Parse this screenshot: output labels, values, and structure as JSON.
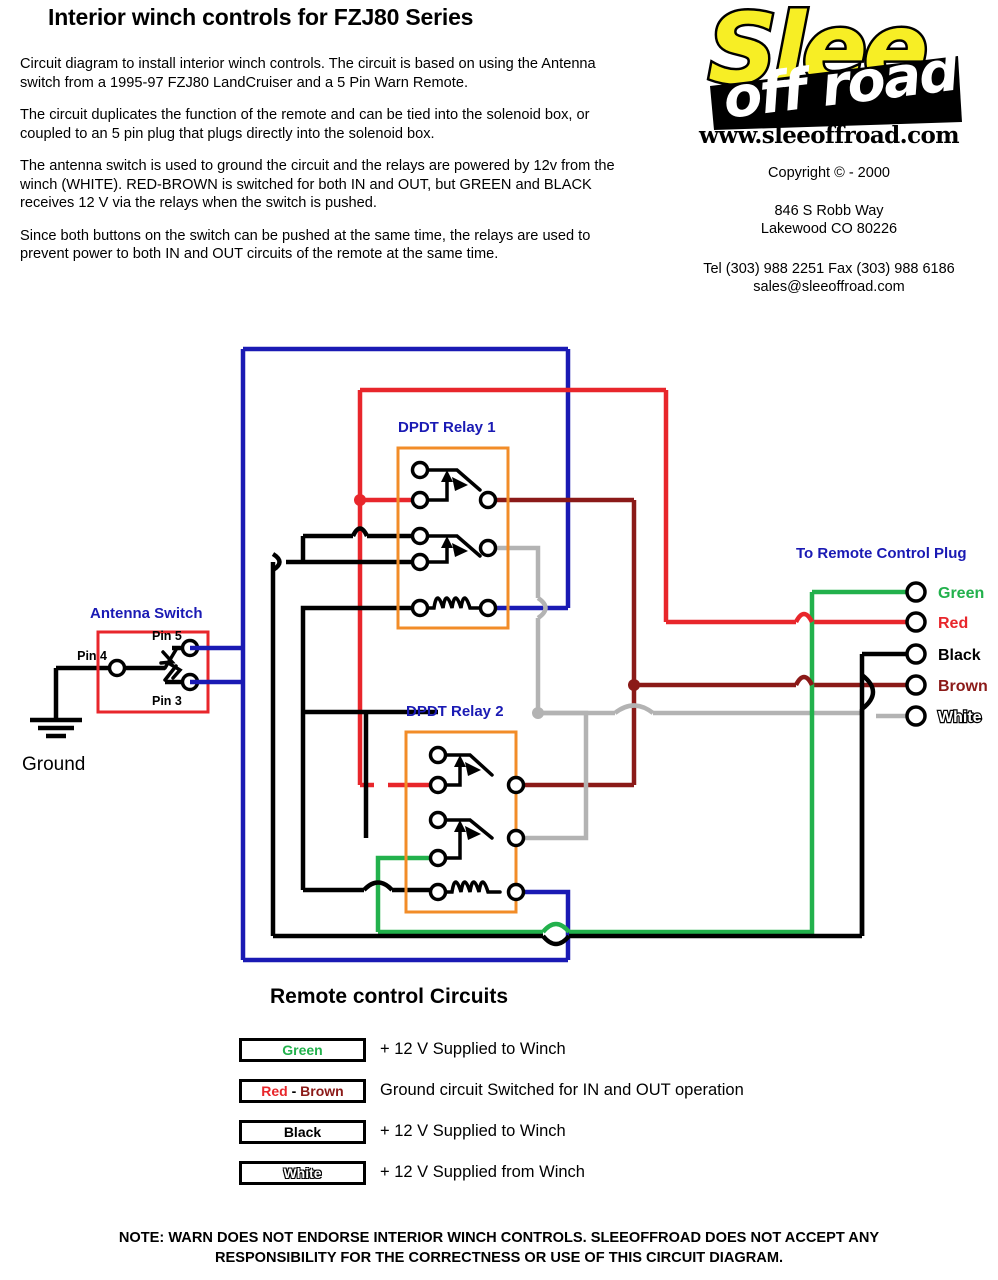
{
  "document": {
    "title": "Interior winch controls for FZJ80 Series",
    "paragraphs": [
      "Circuit diagram to install interior winch controls. The circuit is based on using the Antenna switch from a 1995-97 FZJ80 LandCruiser and a 5 Pin Warn Remote.",
      "The circuit duplicates the function of the remote and can be tied into the solenoid box, or coupled to an 5 pin plug that plugs directly into the solenoid box.",
      "The antenna switch is used to ground the circuit and the relays are powered by 12v from the winch (WHITE). RED-BROWN is switched for both IN and OUT, but GREEN and BLACK receives 12 V via the relays when the switch is pushed.",
      "Since both buttons on the switch can be pushed at the same time, the relays are used to prevent power to both IN and OUT circuits of the remote at the same time."
    ],
    "footer_note_line1": "NOTE: WARN DOES NOT ENDORSE INTERIOR WINCH CONTROLS. SLEEOFFROAD DOES NOT ACCEPT ANY",
    "footer_note_line2": "RESPONSIBILITY FOR THE CORRECTNESS OR USE OF THIS CIRCUIT DIAGRAM."
  },
  "company": {
    "logo_word_top": "Slee",
    "logo_word_bottom": "off road",
    "website": "www.sleeoffroad.com",
    "copyright": "Copyright © - 2000",
    "address_line1": "846 S Robb Way",
    "address_line2": "Lakewood CO 80226",
    "phone_line": "Tel (303) 988 2251 Fax (303) 988 6186",
    "email": "sales@sleeoffroad.com"
  },
  "diagram": {
    "antenna_switch": {
      "title": "Antenna Switch",
      "pin_left": "Pin 4",
      "pin_top": "Pin 5",
      "pin_bottom": "Pin 3",
      "ground_label": "Ground",
      "box_color": "#e8262b"
    },
    "relay1_label": "DPDT Relay 1",
    "relay2_label": "DPDT Relay 2",
    "relay_box_color": "#f28c28",
    "label_color": "#1a1ab4",
    "plug": {
      "title": "To Remote Control Plug",
      "terminals": [
        {
          "name": "Green",
          "color": "#22b14c"
        },
        {
          "name": "Red",
          "color": "#e8262b"
        },
        {
          "name": "Black",
          "color": "#000000"
        },
        {
          "name": "Brown",
          "color": "#8b1a18"
        },
        {
          "name": "White",
          "color": "#ffffff"
        }
      ]
    },
    "wire_colors": {
      "blue": "#1a1ab4",
      "red": "#e8262b",
      "brown": "#8b1a18",
      "black": "#000000",
      "green": "#22b14c",
      "white": "#b3b3b3"
    }
  },
  "legend": {
    "title": "Remote control Circuits",
    "rows": [
      {
        "wire": "Green",
        "wire_color": "#22b14c",
        "description": "+ 12 V Supplied to Winch"
      },
      {
        "wire": "Red - Brown",
        "wire_color": "#e8262b",
        "description": "Ground circuit Switched for IN and OUT operation"
      },
      {
        "wire": "Black",
        "wire_color": "#000000",
        "description": "+ 12 V Supplied to Winch"
      },
      {
        "wire": "White",
        "wire_color": "#ffffff",
        "description": "+ 12 V Supplied from Winch"
      }
    ]
  }
}
